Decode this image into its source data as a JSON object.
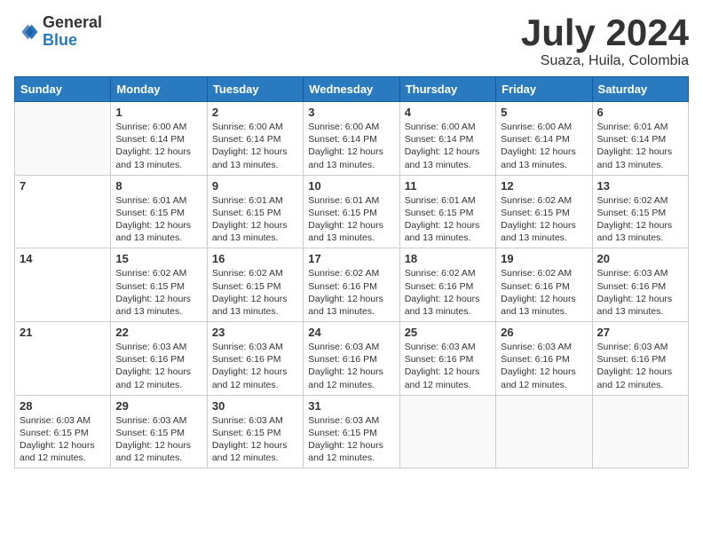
{
  "header": {
    "logo_general": "General",
    "logo_blue": "Blue",
    "month_title": "July 2024",
    "location": "Suaza, Huila, Colombia"
  },
  "weekdays": [
    "Sunday",
    "Monday",
    "Tuesday",
    "Wednesday",
    "Thursday",
    "Friday",
    "Saturday"
  ],
  "weeks": [
    [
      {
        "day": "",
        "info": ""
      },
      {
        "day": "1",
        "info": "Sunrise: 6:00 AM\nSunset: 6:14 PM\nDaylight: 12 hours\nand 13 minutes."
      },
      {
        "day": "2",
        "info": "Sunrise: 6:00 AM\nSunset: 6:14 PM\nDaylight: 12 hours\nand 13 minutes."
      },
      {
        "day": "3",
        "info": "Sunrise: 6:00 AM\nSunset: 6:14 PM\nDaylight: 12 hours\nand 13 minutes."
      },
      {
        "day": "4",
        "info": "Sunrise: 6:00 AM\nSunset: 6:14 PM\nDaylight: 12 hours\nand 13 minutes."
      },
      {
        "day": "5",
        "info": "Sunrise: 6:00 AM\nSunset: 6:14 PM\nDaylight: 12 hours\nand 13 minutes."
      },
      {
        "day": "6",
        "info": "Sunrise: 6:01 AM\nSunset: 6:14 PM\nDaylight: 12 hours\nand 13 minutes."
      }
    ],
    [
      {
        "day": "7",
        "info": ""
      },
      {
        "day": "8",
        "info": "Sunrise: 6:01 AM\nSunset: 6:15 PM\nDaylight: 12 hours\nand 13 minutes."
      },
      {
        "day": "9",
        "info": "Sunrise: 6:01 AM\nSunset: 6:15 PM\nDaylight: 12 hours\nand 13 minutes."
      },
      {
        "day": "10",
        "info": "Sunrise: 6:01 AM\nSunset: 6:15 PM\nDaylight: 12 hours\nand 13 minutes."
      },
      {
        "day": "11",
        "info": "Sunrise: 6:01 AM\nSunset: 6:15 PM\nDaylight: 12 hours\nand 13 minutes."
      },
      {
        "day": "12",
        "info": "Sunrise: 6:02 AM\nSunset: 6:15 PM\nDaylight: 12 hours\nand 13 minutes."
      },
      {
        "day": "13",
        "info": "Sunrise: 6:02 AM\nSunset: 6:15 PM\nDaylight: 12 hours\nand 13 minutes."
      }
    ],
    [
      {
        "day": "14",
        "info": ""
      },
      {
        "day": "15",
        "info": "Sunrise: 6:02 AM\nSunset: 6:15 PM\nDaylight: 12 hours\nand 13 minutes."
      },
      {
        "day": "16",
        "info": "Sunrise: 6:02 AM\nSunset: 6:15 PM\nDaylight: 12 hours\nand 13 minutes."
      },
      {
        "day": "17",
        "info": "Sunrise: 6:02 AM\nSunset: 6:16 PM\nDaylight: 12 hours\nand 13 minutes."
      },
      {
        "day": "18",
        "info": "Sunrise: 6:02 AM\nSunset: 6:16 PM\nDaylight: 12 hours\nand 13 minutes."
      },
      {
        "day": "19",
        "info": "Sunrise: 6:02 AM\nSunset: 6:16 PM\nDaylight: 12 hours\nand 13 minutes."
      },
      {
        "day": "20",
        "info": "Sunrise: 6:03 AM\nSunset: 6:16 PM\nDaylight: 12 hours\nand 13 minutes."
      }
    ],
    [
      {
        "day": "21",
        "info": ""
      },
      {
        "day": "22",
        "info": "Sunrise: 6:03 AM\nSunset: 6:16 PM\nDaylight: 12 hours\nand 12 minutes."
      },
      {
        "day": "23",
        "info": "Sunrise: 6:03 AM\nSunset: 6:16 PM\nDaylight: 12 hours\nand 12 minutes."
      },
      {
        "day": "24",
        "info": "Sunrise: 6:03 AM\nSunset: 6:16 PM\nDaylight: 12 hours\nand 12 minutes."
      },
      {
        "day": "25",
        "info": "Sunrise: 6:03 AM\nSunset: 6:16 PM\nDaylight: 12 hours\nand 12 minutes."
      },
      {
        "day": "26",
        "info": "Sunrise: 6:03 AM\nSunset: 6:16 PM\nDaylight: 12 hours\nand 12 minutes."
      },
      {
        "day": "27",
        "info": "Sunrise: 6:03 AM\nSunset: 6:16 PM\nDaylight: 12 hours\nand 12 minutes."
      }
    ],
    [
      {
        "day": "28",
        "info": "Sunrise: 6:03 AM\nSunset: 6:15 PM\nDaylight: 12 hours\nand 12 minutes."
      },
      {
        "day": "29",
        "info": "Sunrise: 6:03 AM\nSunset: 6:15 PM\nDaylight: 12 hours\nand 12 minutes."
      },
      {
        "day": "30",
        "info": "Sunrise: 6:03 AM\nSunset: 6:15 PM\nDaylight: 12 hours\nand 12 minutes."
      },
      {
        "day": "31",
        "info": "Sunrise: 6:03 AM\nSunset: 6:15 PM\nDaylight: 12 hours\nand 12 minutes."
      },
      {
        "day": "",
        "info": ""
      },
      {
        "day": "",
        "info": ""
      },
      {
        "day": "",
        "info": ""
      }
    ]
  ]
}
